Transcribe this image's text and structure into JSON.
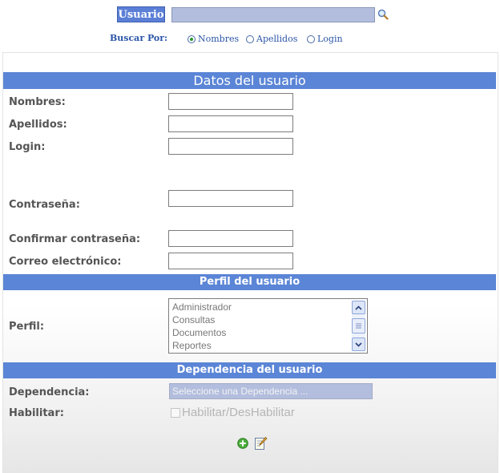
{
  "search": {
    "label": "Usuario",
    "value": "",
    "buscar_por": "Buscar Por:",
    "options": [
      {
        "label": "Nombres",
        "selected": true
      },
      {
        "label": "Apellidos",
        "selected": false
      },
      {
        "label": "Login",
        "selected": false
      }
    ]
  },
  "sections": {
    "datos": "Datos del usuario",
    "perfil": "Perfil del usuario",
    "dependencia": "Dependencia del usuario"
  },
  "form": {
    "nombres": "Nombres:",
    "apellidos": "Apellidos:",
    "login": "Login:",
    "contrasena": "Contraseña:",
    "confirmar": "Confirmar contraseña:",
    "correo": "Correo electrónico:",
    "perfil": "Perfil:",
    "dependencia": "Dependencia:",
    "habilitar": "Habilitar:"
  },
  "perfil_options": [
    "Administrador",
    "Consultas",
    "Documentos",
    "Reportes"
  ],
  "dependencia_placeholder": "Seleccione una Dependencia ...",
  "habilitar_checkbox_label": "Habilitar/DesHabilitar",
  "colors": {
    "section_header": "#5b85d6",
    "search_field": "#b3bede",
    "link_blue": "#2b55a8"
  },
  "icons": {
    "search": "magnifier-icon",
    "add": "add-circle-icon",
    "edit": "edit-note-icon"
  }
}
